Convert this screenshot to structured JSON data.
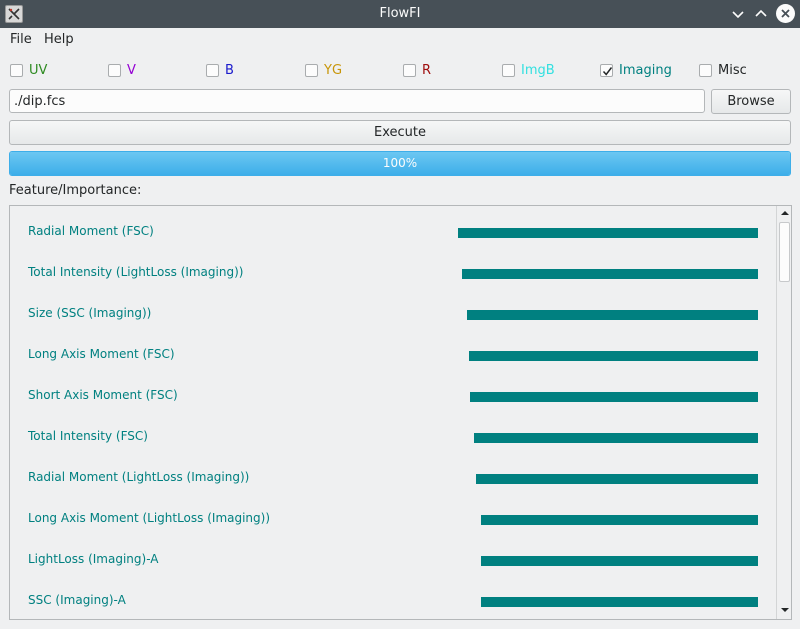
{
  "window": {
    "title": "FlowFI"
  },
  "menu": {
    "file": "File",
    "help": "Help"
  },
  "checkboxes": [
    {
      "label": "UV",
      "checked": false,
      "color": "#2e8b22"
    },
    {
      "label": "V",
      "checked": false,
      "color": "#9400d3"
    },
    {
      "label": "B",
      "checked": false,
      "color": "#1a1acc"
    },
    {
      "label": "YG",
      "checked": false,
      "color": "#c8960a"
    },
    {
      "label": "R",
      "checked": false,
      "color": "#a01010"
    },
    {
      "label": "ImgB",
      "checked": false,
      "color": "#33e0e0"
    },
    {
      "label": "Imaging",
      "checked": true,
      "color": "#008080"
    },
    {
      "label": "Misc",
      "checked": false,
      "color": "#232627"
    }
  ],
  "file": {
    "path": "./dip.fcs",
    "browse_label": "Browse"
  },
  "execute_label": "Execute",
  "progress": {
    "value": 100,
    "text": "100%"
  },
  "section_label": "Feature/Importance:",
  "bar_color": "#008080",
  "features": [
    {
      "name": "Radial Moment (FSC)",
      "importance": 1.0
    },
    {
      "name": "Total Intensity (LightLoss (Imaging))",
      "importance": 0.987
    },
    {
      "name": "Size (SSC (Imaging))",
      "importance": 0.97
    },
    {
      "name": "Long Axis Moment (FSC)",
      "importance": 0.963
    },
    {
      "name": "Short Axis Moment (FSC)",
      "importance": 0.96
    },
    {
      "name": "Total Intensity (FSC)",
      "importance": 0.947
    },
    {
      "name": "Radial Moment (LightLoss (Imaging))",
      "importance": 0.94
    },
    {
      "name": "Long Axis Moment (LightLoss (Imaging))",
      "importance": 0.923
    },
    {
      "name": "LightLoss (Imaging)-A",
      "importance": 0.923
    },
    {
      "name": "SSC (Imaging)-A",
      "importance": 0.923
    }
  ],
  "icons": {
    "app": "flowfi-app-icon",
    "minimize": "chevron-down-icon",
    "maximize": "chevron-up-icon",
    "close": "close-icon",
    "scroll_up": "arrow-up-icon",
    "scroll_down": "arrow-down-icon",
    "check": "checkmark-icon"
  }
}
